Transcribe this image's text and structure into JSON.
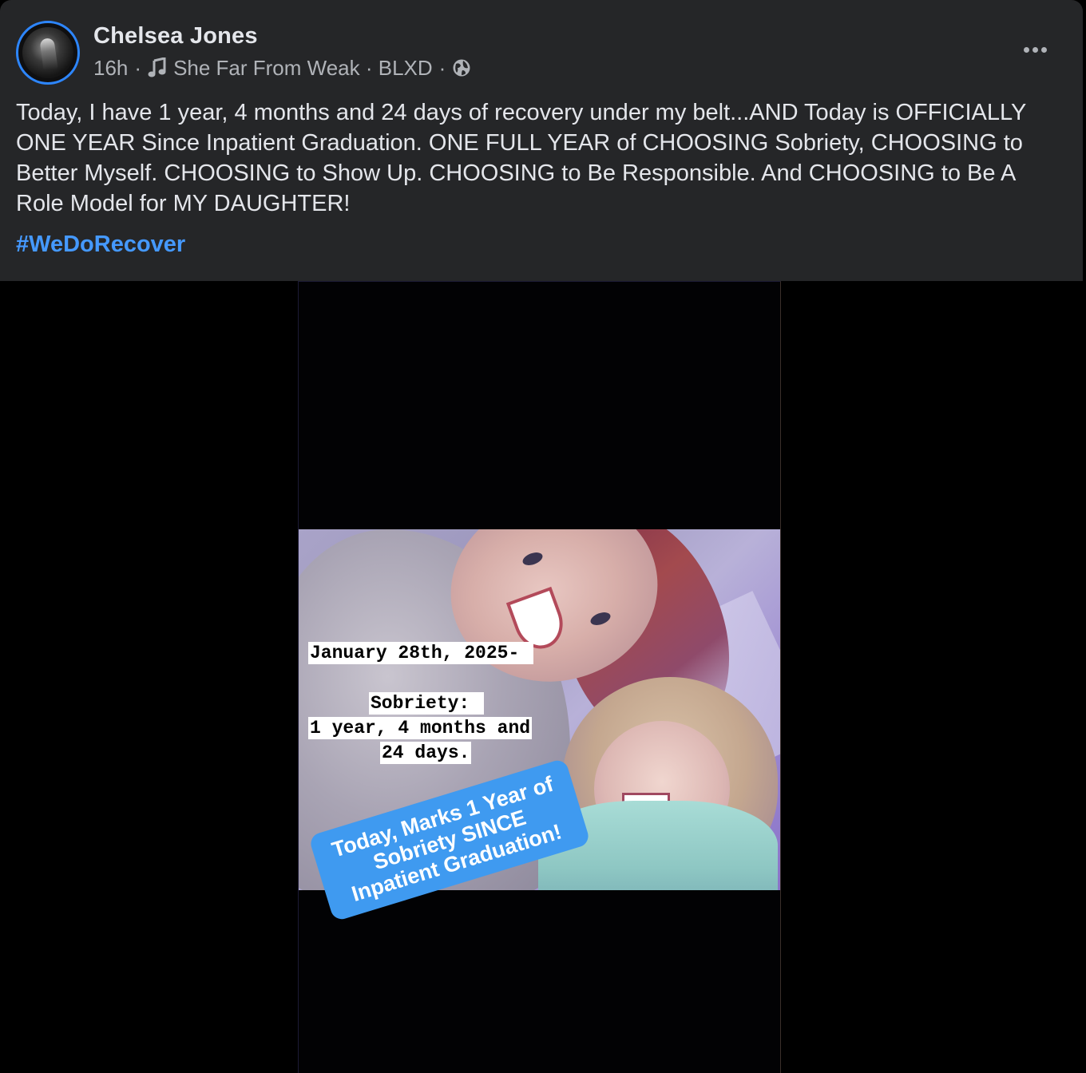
{
  "post": {
    "author": "Chelsea Jones",
    "time": "16h",
    "song": "She Far From Weak · BLXD",
    "separator": "·",
    "body": "Today, I have 1 year, 4 months and 24 days of recovery under my belt...AND Today is OFFICIALLY ONE YEAR Since Inpatient Graduation. ONE FULL YEAR of CHOOSING Sobriety, CHOOSING to Better Myself. CHOOSING to Show Up. CHOOSING to Be Responsible. And CHOOSING to Be A Role Model for MY DAUGHTER!",
    "hashtag": "#WeDoRecover"
  },
  "media": {
    "caption_date": "January 28th, 2025-",
    "caption_sobriety": "Sobriety:",
    "caption_duration": "1 year, 4 months and",
    "caption_days": "24 days.",
    "sticker_text": "Today, Marks 1 Year of Sobriety SINCE Inpatient Graduation!"
  },
  "icons": {
    "music": "music-note-icon",
    "audience": "globe-icon",
    "more": "more-options-icon"
  },
  "colors": {
    "card_bg": "#252628",
    "text_primary": "#e4e6eb",
    "text_secondary": "#b0b3b8",
    "hashtag": "#4599ff",
    "avatar_ring": "#2d86ff",
    "sticker": "#3f9af0"
  }
}
